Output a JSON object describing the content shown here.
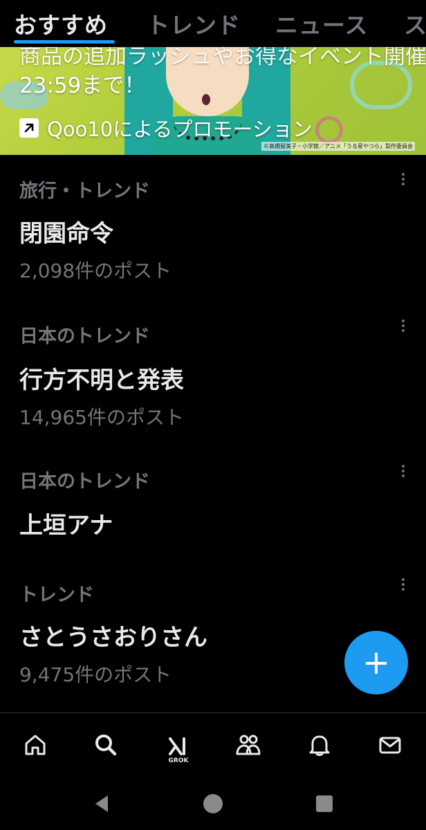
{
  "tabs": [
    {
      "label": "おすすめ",
      "active": true
    },
    {
      "label": "トレンド",
      "active": false
    },
    {
      "label": "ニュース",
      "active": false
    },
    {
      "label": "ス",
      "active": false
    }
  ],
  "promo": {
    "overflow_text": "商品の追加ラッシュやお得なイベント開催",
    "text": "23:59まで！",
    "label": "Qoo10によるプロモーション",
    "copyright": "©高橋留美子・小学館／アニメ「うる星やつら」製作委員会"
  },
  "trends": [
    {
      "category": "旅行・トレンド",
      "title": "閉園命令",
      "count": "2,098件のポスト"
    },
    {
      "category": "日本のトレンド",
      "title": "行方不明と発表",
      "count": "14,965件のポスト"
    },
    {
      "category": "日本のトレンド",
      "title": "上垣アナ",
      "count": ""
    },
    {
      "category": "トレンド",
      "title": "さとうさおりさん",
      "count": "9,475件のポスト"
    }
  ],
  "fab": {
    "symbol": "+"
  },
  "bottom_nav": {
    "items": [
      "home-icon",
      "search-icon",
      "grok-icon",
      "communities-icon",
      "notifications-icon",
      "messages-icon"
    ],
    "grok_label": "GROK"
  },
  "colors": {
    "accent": "#1d9bf0",
    "background": "#000000",
    "muted": "#71767b",
    "text": "#e7e9ea"
  }
}
